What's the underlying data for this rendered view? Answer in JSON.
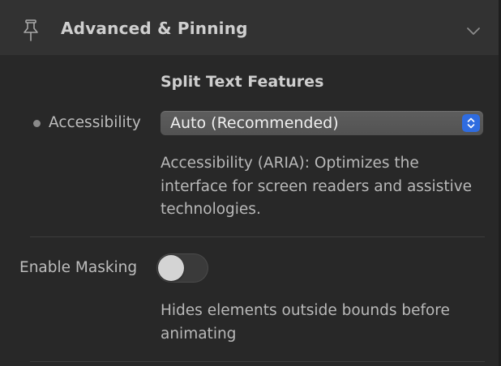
{
  "header": {
    "title": "Advanced & Pinning",
    "icon": "pin-icon",
    "collapse_icon": "chevron-down-icon"
  },
  "section": {
    "title": "Split Text Features"
  },
  "accessibility": {
    "label": "Accessibility",
    "value": "Auto (Recommended)",
    "help": "Accessibility (ARIA): Optimizes the interface for screen readers and assistive technologies."
  },
  "masking": {
    "label": "Enable Masking",
    "enabled": false,
    "help": "Hides elements outside bounds before animating"
  },
  "colors": {
    "background": "#282828",
    "header": "#323232",
    "accent": "#2f6ce0"
  }
}
